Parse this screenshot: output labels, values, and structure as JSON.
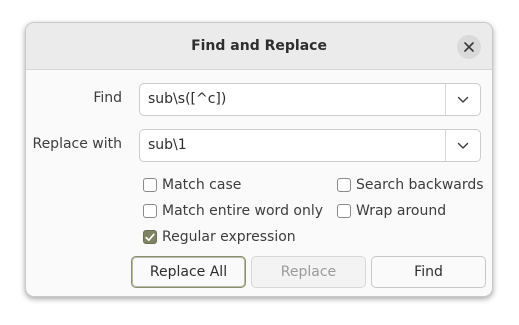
{
  "dialog": {
    "title": "Find and Replace"
  },
  "find": {
    "label": "Find",
    "value": "sub\\s([^c])"
  },
  "replace": {
    "label": "Replace with",
    "value": "sub\\1"
  },
  "options": {
    "match_case": {
      "label": "Match case",
      "checked": false
    },
    "search_backwards": {
      "label": "Search backwards",
      "checked": false
    },
    "match_entire_word": {
      "label": "Match entire word only",
      "checked": false
    },
    "wrap_around": {
      "label": "Wrap around",
      "checked": false
    },
    "regular_expression": {
      "label": "Regular expression",
      "checked": true
    }
  },
  "buttons": {
    "replace_all": "Replace All",
    "replace": "Replace",
    "find": "Find"
  },
  "colors": {
    "accent": "#7d8363"
  }
}
